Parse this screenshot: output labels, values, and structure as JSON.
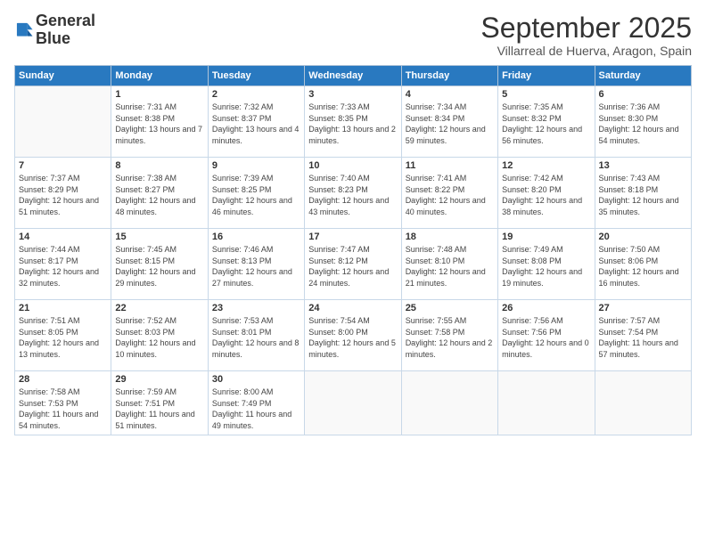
{
  "logo": {
    "line1": "General",
    "line2": "Blue"
  },
  "header": {
    "month": "September 2025",
    "location": "Villarreal de Huerva, Aragon, Spain"
  },
  "days_of_week": [
    "Sunday",
    "Monday",
    "Tuesday",
    "Wednesday",
    "Thursday",
    "Friday",
    "Saturday"
  ],
  "weeks": [
    [
      {
        "day": "",
        "sunrise": "",
        "sunset": "",
        "daylight": ""
      },
      {
        "day": "1",
        "sunrise": "Sunrise: 7:31 AM",
        "sunset": "Sunset: 8:38 PM",
        "daylight": "Daylight: 13 hours and 7 minutes."
      },
      {
        "day": "2",
        "sunrise": "Sunrise: 7:32 AM",
        "sunset": "Sunset: 8:37 PM",
        "daylight": "Daylight: 13 hours and 4 minutes."
      },
      {
        "day": "3",
        "sunrise": "Sunrise: 7:33 AM",
        "sunset": "Sunset: 8:35 PM",
        "daylight": "Daylight: 13 hours and 2 minutes."
      },
      {
        "day": "4",
        "sunrise": "Sunrise: 7:34 AM",
        "sunset": "Sunset: 8:34 PM",
        "daylight": "Daylight: 12 hours and 59 minutes."
      },
      {
        "day": "5",
        "sunrise": "Sunrise: 7:35 AM",
        "sunset": "Sunset: 8:32 PM",
        "daylight": "Daylight: 12 hours and 56 minutes."
      },
      {
        "day": "6",
        "sunrise": "Sunrise: 7:36 AM",
        "sunset": "Sunset: 8:30 PM",
        "daylight": "Daylight: 12 hours and 54 minutes."
      }
    ],
    [
      {
        "day": "7",
        "sunrise": "Sunrise: 7:37 AM",
        "sunset": "Sunset: 8:29 PM",
        "daylight": "Daylight: 12 hours and 51 minutes."
      },
      {
        "day": "8",
        "sunrise": "Sunrise: 7:38 AM",
        "sunset": "Sunset: 8:27 PM",
        "daylight": "Daylight: 12 hours and 48 minutes."
      },
      {
        "day": "9",
        "sunrise": "Sunrise: 7:39 AM",
        "sunset": "Sunset: 8:25 PM",
        "daylight": "Daylight: 12 hours and 46 minutes."
      },
      {
        "day": "10",
        "sunrise": "Sunrise: 7:40 AM",
        "sunset": "Sunset: 8:23 PM",
        "daylight": "Daylight: 12 hours and 43 minutes."
      },
      {
        "day": "11",
        "sunrise": "Sunrise: 7:41 AM",
        "sunset": "Sunset: 8:22 PM",
        "daylight": "Daylight: 12 hours and 40 minutes."
      },
      {
        "day": "12",
        "sunrise": "Sunrise: 7:42 AM",
        "sunset": "Sunset: 8:20 PM",
        "daylight": "Daylight: 12 hours and 38 minutes."
      },
      {
        "day": "13",
        "sunrise": "Sunrise: 7:43 AM",
        "sunset": "Sunset: 8:18 PM",
        "daylight": "Daylight: 12 hours and 35 minutes."
      }
    ],
    [
      {
        "day": "14",
        "sunrise": "Sunrise: 7:44 AM",
        "sunset": "Sunset: 8:17 PM",
        "daylight": "Daylight: 12 hours and 32 minutes."
      },
      {
        "day": "15",
        "sunrise": "Sunrise: 7:45 AM",
        "sunset": "Sunset: 8:15 PM",
        "daylight": "Daylight: 12 hours and 29 minutes."
      },
      {
        "day": "16",
        "sunrise": "Sunrise: 7:46 AM",
        "sunset": "Sunset: 8:13 PM",
        "daylight": "Daylight: 12 hours and 27 minutes."
      },
      {
        "day": "17",
        "sunrise": "Sunrise: 7:47 AM",
        "sunset": "Sunset: 8:12 PM",
        "daylight": "Daylight: 12 hours and 24 minutes."
      },
      {
        "day": "18",
        "sunrise": "Sunrise: 7:48 AM",
        "sunset": "Sunset: 8:10 PM",
        "daylight": "Daylight: 12 hours and 21 minutes."
      },
      {
        "day": "19",
        "sunrise": "Sunrise: 7:49 AM",
        "sunset": "Sunset: 8:08 PM",
        "daylight": "Daylight: 12 hours and 19 minutes."
      },
      {
        "day": "20",
        "sunrise": "Sunrise: 7:50 AM",
        "sunset": "Sunset: 8:06 PM",
        "daylight": "Daylight: 12 hours and 16 minutes."
      }
    ],
    [
      {
        "day": "21",
        "sunrise": "Sunrise: 7:51 AM",
        "sunset": "Sunset: 8:05 PM",
        "daylight": "Daylight: 12 hours and 13 minutes."
      },
      {
        "day": "22",
        "sunrise": "Sunrise: 7:52 AM",
        "sunset": "Sunset: 8:03 PM",
        "daylight": "Daylight: 12 hours and 10 minutes."
      },
      {
        "day": "23",
        "sunrise": "Sunrise: 7:53 AM",
        "sunset": "Sunset: 8:01 PM",
        "daylight": "Daylight: 12 hours and 8 minutes."
      },
      {
        "day": "24",
        "sunrise": "Sunrise: 7:54 AM",
        "sunset": "Sunset: 8:00 PM",
        "daylight": "Daylight: 12 hours and 5 minutes."
      },
      {
        "day": "25",
        "sunrise": "Sunrise: 7:55 AM",
        "sunset": "Sunset: 7:58 PM",
        "daylight": "Daylight: 12 hours and 2 minutes."
      },
      {
        "day": "26",
        "sunrise": "Sunrise: 7:56 AM",
        "sunset": "Sunset: 7:56 PM",
        "daylight": "Daylight: 12 hours and 0 minutes."
      },
      {
        "day": "27",
        "sunrise": "Sunrise: 7:57 AM",
        "sunset": "Sunset: 7:54 PM",
        "daylight": "Daylight: 11 hours and 57 minutes."
      }
    ],
    [
      {
        "day": "28",
        "sunrise": "Sunrise: 7:58 AM",
        "sunset": "Sunset: 7:53 PM",
        "daylight": "Daylight: 11 hours and 54 minutes."
      },
      {
        "day": "29",
        "sunrise": "Sunrise: 7:59 AM",
        "sunset": "Sunset: 7:51 PM",
        "daylight": "Daylight: 11 hours and 51 minutes."
      },
      {
        "day": "30",
        "sunrise": "Sunrise: 8:00 AM",
        "sunset": "Sunset: 7:49 PM",
        "daylight": "Daylight: 11 hours and 49 minutes."
      },
      {
        "day": "",
        "sunrise": "",
        "sunset": "",
        "daylight": ""
      },
      {
        "day": "",
        "sunrise": "",
        "sunset": "",
        "daylight": ""
      },
      {
        "day": "",
        "sunrise": "",
        "sunset": "",
        "daylight": ""
      },
      {
        "day": "",
        "sunrise": "",
        "sunset": "",
        "daylight": ""
      }
    ]
  ]
}
